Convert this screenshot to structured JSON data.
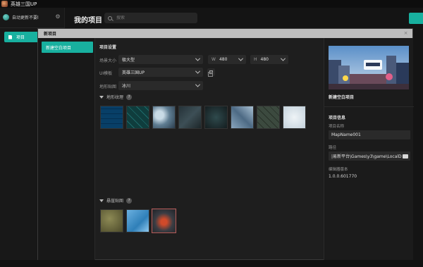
{
  "app": {
    "title": "英雄三国UP"
  },
  "sidebar": {
    "user_name": "自动更新不要l",
    "items": [
      {
        "label": "项目"
      }
    ]
  },
  "header": {
    "title": "我的项目",
    "search_placeholder": "搜索"
  },
  "dialog": {
    "title": "新项目",
    "templates": [
      {
        "label": "新建空白项目"
      }
    ],
    "settings": {
      "section_title": "项目设置",
      "scene_size_label": "场景大小",
      "scene_size_value": "极大型",
      "width_prefix": "W",
      "width_value": "480",
      "height_prefix": "H",
      "height_value": "480",
      "ui_template_label": "UI模板",
      "ui_template_value": "英雄三国UP",
      "terrain_label": "地形贴图",
      "terrain_value": "冰川",
      "terrain_textures_label": "地形纹理",
      "cliff_textures_label": "悬崖贴图"
    },
    "right": {
      "preview_name": "新建空白项目",
      "info_title": "项目信息",
      "project_name_label": "项目名称",
      "project_name_value": "MapName001",
      "path_label": "路径",
      "path_value": "|易新平台\\Games\\y3\\game\\LocalD",
      "editor_version_label": "编辑器版本",
      "editor_version_value": "1.0.0.601770"
    }
  },
  "colors": {
    "accent": "#18b09f",
    "background": "#141414",
    "panel": "#1e1e1e"
  },
  "icons": [
    "app-logo-icon",
    "settings-gear-icon",
    "document-icon",
    "search-icon",
    "copy-icon",
    "help-icon",
    "folder-icon",
    "close-icon"
  ]
}
